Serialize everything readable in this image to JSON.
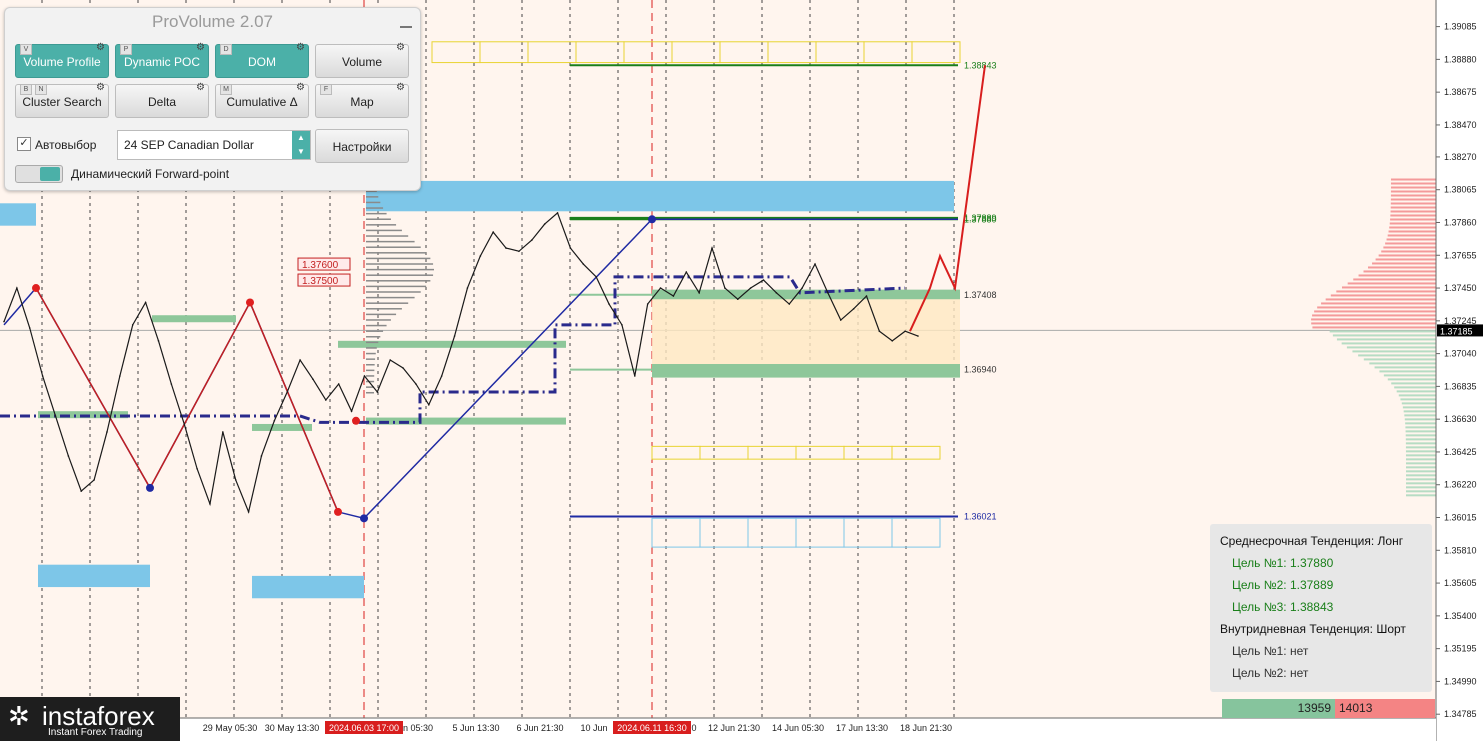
{
  "panel": {
    "title": "ProVolume 2.07",
    "buttons": [
      {
        "label": "Volume Profile",
        "k1": "V",
        "k2": "",
        "active": true
      },
      {
        "label": "Dynamic POC",
        "k1": "P",
        "k2": "",
        "active": true
      },
      {
        "label": "DOM",
        "k1": "D",
        "k2": "",
        "active": true
      },
      {
        "label": "Volume",
        "k1": "",
        "k2": "",
        "active": false
      },
      {
        "label": "Cluster Search",
        "k1": "B",
        "k2": "N",
        "active": false
      },
      {
        "label": "Delta",
        "k1": "",
        "k2": "",
        "active": false
      },
      {
        "label": "Cumulative Δ",
        "k1": "M",
        "k2": "",
        "active": false
      },
      {
        "label": "Map",
        "k1": "F",
        "k2": "",
        "active": false
      }
    ],
    "auto_label": "Автовыбор",
    "instrument": "24 SEP Canadian Dollar",
    "settings_label": "Настройки",
    "forward_label": "Динамический Forward-point"
  },
  "info_box": {
    "mid_trend": "Среднесрочная Тенденция: Лонг",
    "mid_targets": [
      "Цель №1: 1.37880",
      "Цель №2: 1.37889",
      "Цель №3: 1.38843"
    ],
    "intraday_trend": "Внутридневная Тенденция: Шорт",
    "intraday_targets": [
      "Цель №1: нет",
      "Цель №2: нет"
    ]
  },
  "volume_bar": {
    "buy": "13959",
    "sell": "14013"
  },
  "logo": {
    "name": "instaforex",
    "tagline": "Instant Forex Trading"
  },
  "colors": {
    "up_target": "#d81e1e",
    "trend_line": "#1f2aa3",
    "support": "#8ec79a",
    "resistance": "#7dc6e8",
    "mid_zone": "#ffe9c2",
    "price_line": "#1a1a1a"
  },
  "chart_data": {
    "type": "line",
    "symbol": "24 SEP Canadian Dollar",
    "ylim": [
      1.3478,
      1.3912
    ],
    "y_ticks": [
      "1.39085",
      "1.38880",
      "1.38675",
      "1.38470",
      "1.38270",
      "1.38065",
      "1.37860",
      "1.37655",
      "1.37450",
      "1.37245",
      "1.37040",
      "1.36835",
      "1.36630",
      "1.36425",
      "1.36220",
      "1.36015",
      "1.35810",
      "1.35605",
      "1.35400",
      "1.35195",
      "1.34990",
      "1.34785"
    ],
    "current_price": "1.37185",
    "x_labels": [
      "29 May 05:30",
      "30 May 13:30",
      "2024.06.03 17:00",
      "n 05:30",
      "5 Jun 13:30",
      "6 Jun 21:30",
      "10 Jun",
      "2024.06.11 16:30",
      "0",
      "12 Jun 21:30",
      "14 Jun 05:30",
      "17 Jun 13:30",
      "18 Jun 21:30"
    ],
    "levels": [
      {
        "label": "1.38843",
        "value": 1.38843
      },
      {
        "label": "1.37889",
        "value": 1.37889
      },
      {
        "label": "1.37880",
        "value": 1.3788
      },
      {
        "label": "1.37408",
        "value": 1.37408
      },
      {
        "label": "1.36940",
        "value": 1.3694
      },
      {
        "label": "1.36021",
        "value": 1.36021
      }
    ],
    "price_tags": [
      "1.37600",
      "1.37500"
    ],
    "series": [
      {
        "values": [
          1.3724,
          1.3745,
          1.372,
          1.369,
          1.3665,
          1.364,
          1.3618,
          1.3625,
          1.3655,
          1.369,
          1.3722,
          1.3736,
          1.3712,
          1.3685,
          1.366,
          1.3632,
          1.361,
          1.3655,
          1.3625,
          1.3605,
          1.364,
          1.3662,
          1.368,
          1.37,
          1.3688,
          1.3675,
          1.3685,
          1.3668,
          1.369,
          1.368,
          1.37,
          1.3695,
          1.3685,
          1.3672,
          1.369,
          1.3715,
          1.3745,
          1.3765,
          1.378,
          1.377,
          1.3768,
          1.3775,
          1.3785,
          1.3792,
          1.377,
          1.376,
          1.3752,
          1.3735,
          1.3722,
          1.369,
          1.3735,
          1.3745,
          1.374,
          1.3755,
          1.3742,
          1.377,
          1.3745,
          1.3738,
          1.3745,
          1.375,
          1.3742,
          1.3735,
          1.3745,
          1.376,
          1.3742,
          1.3725,
          1.3732,
          1.374,
          1.3718,
          1.3712,
          1.3718,
          1.3715
        ]
      }
    ],
    "projection": [
      1.3718,
      1.3745,
      1.3765,
      1.3745,
      1.38843
    ]
  }
}
